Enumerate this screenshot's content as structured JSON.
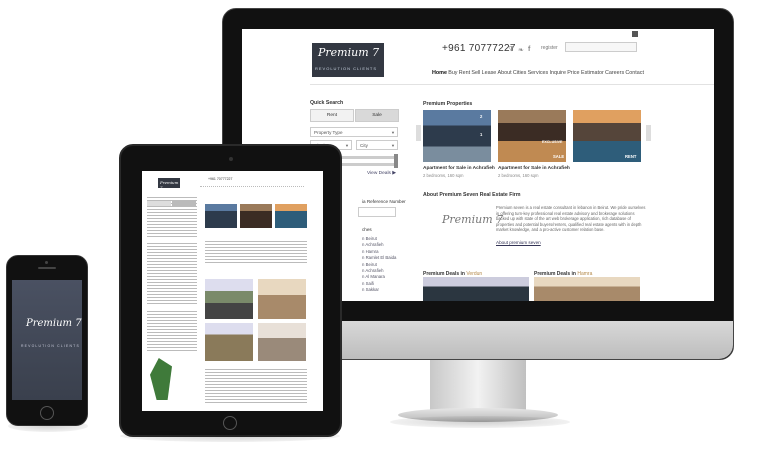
{
  "desktop": {
    "logo": "Premium 7",
    "logo_subtitle": "REVOLUTION CLIENTS",
    "phone": "+961 70777227",
    "register": "register",
    "nav": [
      "Home",
      "Buy",
      "Rent",
      "Sell",
      "Lease",
      "About",
      "Cities",
      "Services",
      "Inquire",
      "Price Estimator",
      "Careers",
      "Contact"
    ],
    "quick_search": {
      "title": "Quick Search",
      "rent": "Rent",
      "sale": "Sale",
      "property_type": "Property Type",
      "district": "District",
      "city": "City",
      "view_deals": "View Deals",
      "reference_label": "ia Reference Number",
      "section_label": "ches",
      "list": [
        "n Beirut",
        "n Achrafieh",
        "n Hamra",
        "n Ramlet El Baida",
        "n Beirut",
        "n Achrafieh",
        "n Al Manara",
        "n Saifi",
        "n Sakkar"
      ]
    },
    "premium": {
      "title": "Premium Properties",
      "properties": [
        {
          "caption": "Apartment for Sale in Achrafieh",
          "sub": "2 bedrooms, 160 sqm",
          "tag": ""
        },
        {
          "caption": "Apartment for Sale in Achrafieh",
          "sub": "2 bedrooms, 160 sqm",
          "tag": "SALE"
        },
        {
          "caption": "",
          "sub": "",
          "tag": "RENT"
        }
      ],
      "counts": [
        "2",
        "1"
      ],
      "exclusive": "EXCLUSIVE"
    },
    "about": {
      "title": "About Premium Seven Real Estate Firm",
      "text": "Premium seven is a real estate consultant in lebanon in Beirut. We pride ourselves in offering turn-key professional real estate advisory and brokerage solutions backed up with state of the art web brokerage application, rich database of properties and potential buyers/renters, qualified real estate agents with in depth market knowledge, and a pro-active customer relation base.",
      "link": "About premium seven",
      "signature": "Premium 7"
    },
    "deals": [
      {
        "prefix": "Premium Deals in",
        "city": "Verdun"
      },
      {
        "prefix": "Premium Deals in",
        "city": "Hamra"
      }
    ]
  },
  "tablet": {
    "logo": "Premium 7",
    "phone": "+961 70777227"
  },
  "phone": {
    "logo": "Premium 7",
    "subtitle": "REVOLUTION CLIENTS"
  }
}
